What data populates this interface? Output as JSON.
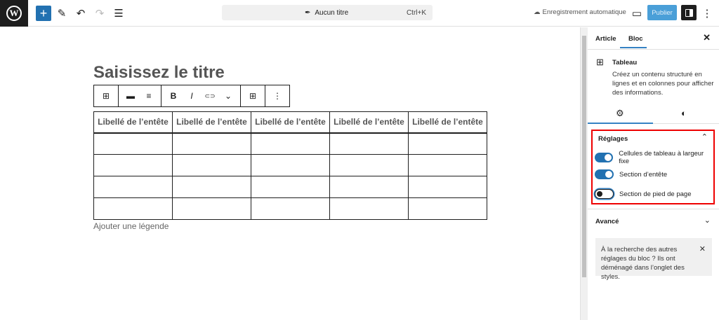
{
  "topbar": {
    "logo": "W",
    "add": "+",
    "edit": "✎",
    "undo": "↶",
    "redo": "↷",
    "list": "☰",
    "doc_icon": "✒",
    "doc_title": "Aucun titre",
    "shortcut": "Ctrl+K",
    "save_icon": "☁",
    "save_status": "Enregistrement automatique",
    "preview": "▭",
    "publish": "Publier",
    "more": "⋮"
  },
  "editor": {
    "title_placeholder": "Saisissez le titre",
    "toolbar": {
      "table": "⊞",
      "align_wide": "▬",
      "align_left": "≡",
      "bold": "B",
      "italic": "I",
      "link": "⊂⊃",
      "more_rich": "⌄",
      "edit_table": "⊞",
      "options": "⋮"
    },
    "headers": [
      "Libellé de l’entête",
      "Libellé de l’entête",
      "Libellé de l’entête",
      "Libellé de l’entête",
      "Libellé de l’entête"
    ],
    "rows": 4,
    "caption_placeholder": "Ajouter une légende"
  },
  "sidebar": {
    "tab_article": "Article",
    "tab_bloc": "Bloc",
    "close": "✕",
    "block_icon": "⊞",
    "block_name": "Tableau",
    "block_desc": "Créez un contenu structuré en lignes et en colonnes pour afficher des informations.",
    "settings_icon": "⚙",
    "styles_icon": "◐",
    "settings": {
      "title": "Réglages",
      "chevron": "⌃",
      "toggles": [
        {
          "label": "Cellules de tableau à largeur fixe",
          "on": true
        },
        {
          "label": "Section d’entête",
          "on": true
        },
        {
          "label": "Section de pied de page",
          "on": false
        }
      ]
    },
    "advanced": {
      "title": "Avancé",
      "chevron": "⌄"
    },
    "notice": {
      "text": "À la recherche des autres réglages du bloc ? Ils ont déménagé dans l’onglet des styles.",
      "close": "✕"
    }
  },
  "colors": {
    "accent": "#2271b1",
    "highlight": "#ee0000"
  }
}
